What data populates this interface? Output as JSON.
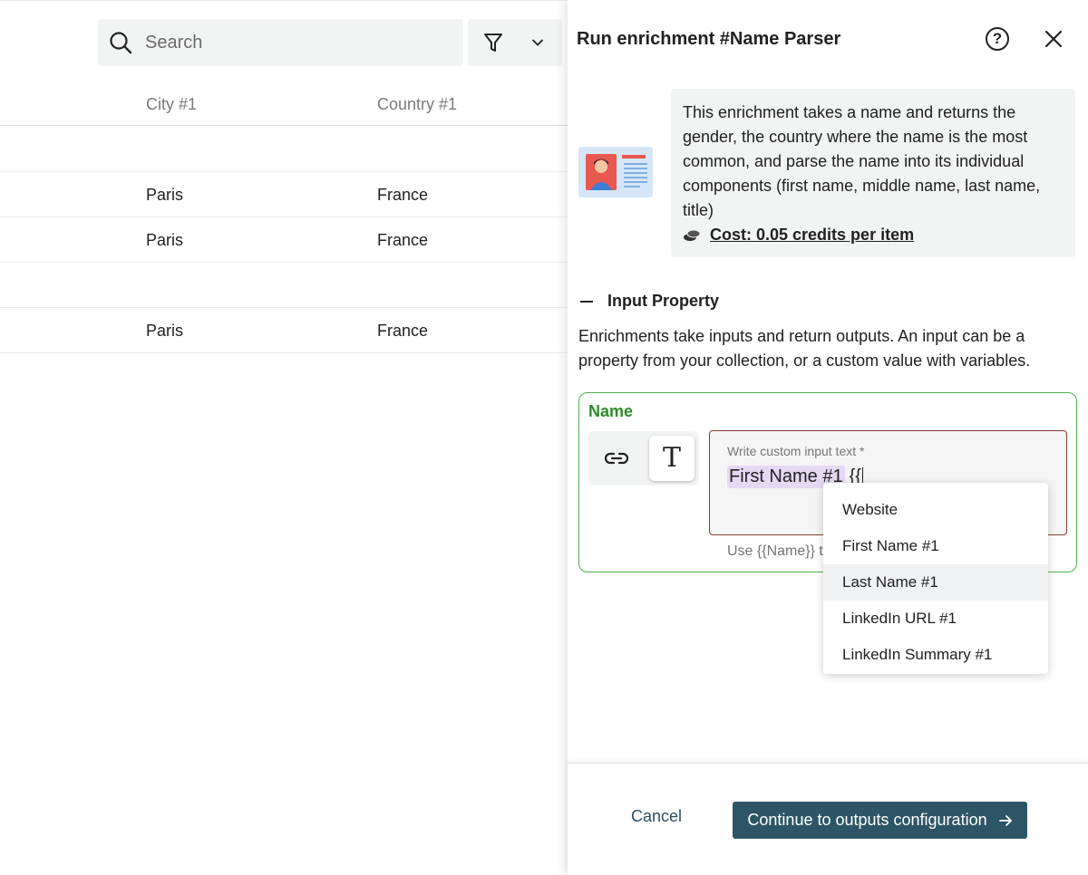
{
  "search": {
    "placeholder": "Search"
  },
  "table": {
    "headers": [
      "City #1",
      "Country #1"
    ],
    "rows": [
      [
        "",
        ""
      ],
      [
        "Paris",
        "France"
      ],
      [
        "Paris",
        "France"
      ],
      [
        "",
        ""
      ],
      [
        "Paris",
        "France"
      ]
    ]
  },
  "drawer": {
    "title": "Run enrichment #Name Parser",
    "help_symbol": "?",
    "info_text": "This enrichment takes a name and returns the gender, the country where the name is the most common, and parse the name into its individual components (first name, middle name, last name, title)",
    "cost_label": "Cost: 0.05 credits per item",
    "section_title": "Input Property",
    "section_desc": "Enrichments take inputs and return outputs. An input can be a property from your collection, or a custom value with variables.",
    "input": {
      "label": "Name",
      "mode_text_glyph": "T",
      "field_label": "Write custom input text *",
      "chip_value": "First Name #1",
      "typed_value": "{{",
      "helper_text": "Use {{Name}} to"
    },
    "dropdown": {
      "items": [
        "Website",
        "First Name #1",
        "Last Name #1",
        "LinkedIn URL #1",
        "LinkedIn Summary #1"
      ],
      "highlighted": "Last Name #1"
    },
    "footer": {
      "cancel_label": "Cancel",
      "continue_label": "Continue to outputs configuration"
    }
  },
  "colors": {
    "accent": "#2d5565",
    "success_border": "#4caf50",
    "name_label": "#2e8b2e",
    "chip": "#e4d9f3",
    "error_border": "#8b3a3a"
  },
  "icons": [
    "search-icon",
    "filter-icon",
    "chevron-down-icon",
    "help-icon",
    "close-icon",
    "id-card-icon",
    "coins-icon",
    "minus-icon",
    "link-icon",
    "text-icon",
    "arrow-right-icon"
  ]
}
